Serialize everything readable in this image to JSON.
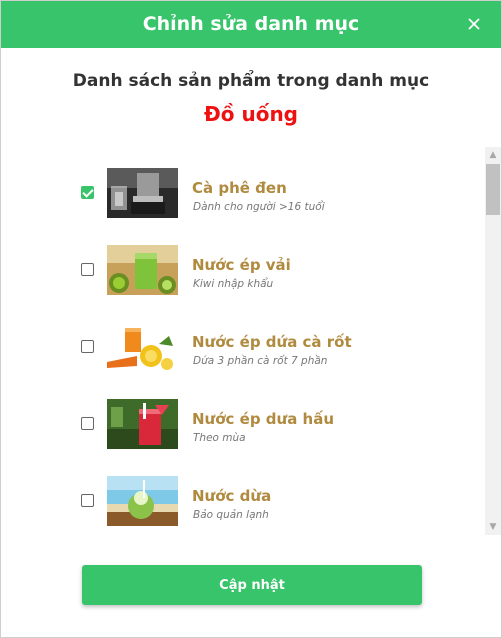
{
  "dialog": {
    "title": "Chỉnh sửa danh mục",
    "close_icon": "close-icon",
    "subtitle": "Danh sách sản phẩm trong danh mục",
    "category_name": "Đồ uống"
  },
  "products": [
    {
      "name": "Cà phê đen",
      "description": "Dành cho người >16 tuổi",
      "checked": true,
      "thumbnail_icon": "black-coffee-image"
    },
    {
      "name": "Nước ép vải",
      "description": "Kiwi nhập khẩu",
      "checked": false,
      "thumbnail_icon": "kiwi-juice-image"
    },
    {
      "name": "Nước ép dứa cà rốt",
      "description": "Dứa 3 phần cà rốt 7 phần",
      "checked": false,
      "thumbnail_icon": "pineapple-carrot-juice-image"
    },
    {
      "name": "Nước ép dưa hấu",
      "description": "Theo mùa",
      "checked": false,
      "thumbnail_icon": "watermelon-juice-image"
    },
    {
      "name": "Nước dừa",
      "description": "Bảo quản lạnh",
      "checked": false,
      "thumbnail_icon": "coconut-water-image"
    }
  ],
  "footer": {
    "update_label": "Cập nhật"
  },
  "colors": {
    "accent": "#37c46a",
    "category": "#ee1111",
    "product_name": "#b08a3e"
  }
}
